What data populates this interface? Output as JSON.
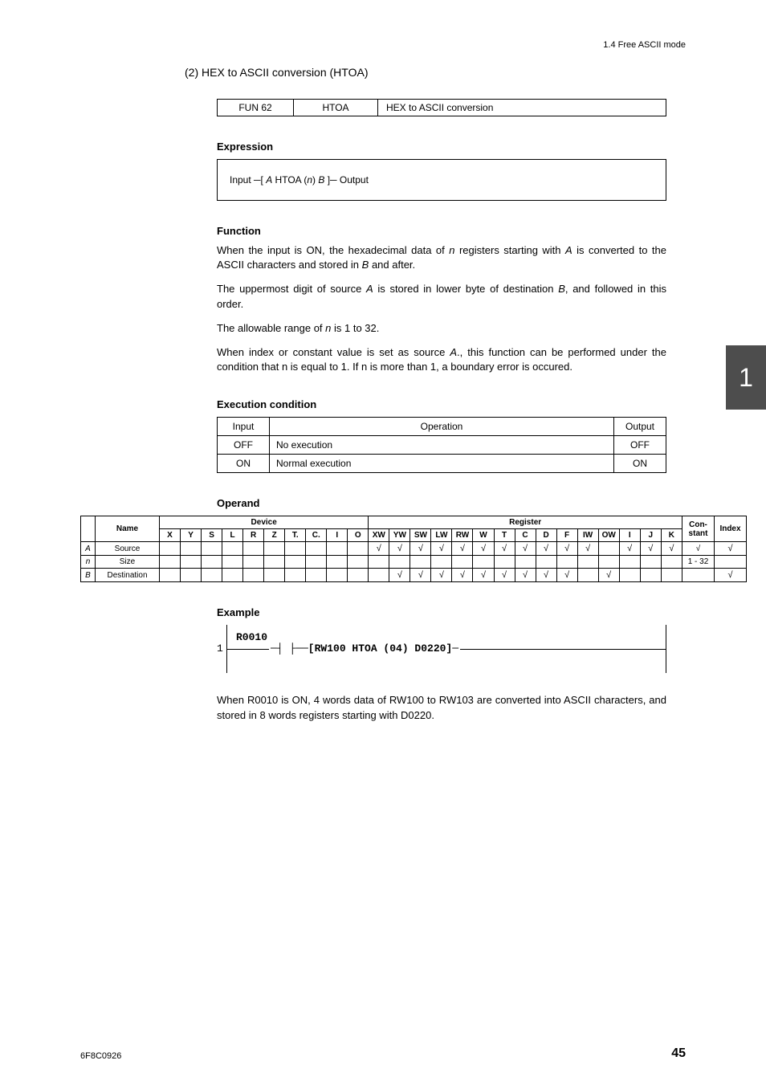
{
  "header": "1.4  Free ASCII mode",
  "section": "(2)  HEX to ASCII conversion (HTOA)",
  "info": {
    "col1": "FUN 62",
    "col2": "HTOA",
    "col3": "HEX to ASCII conversion"
  },
  "h_expr": "Expression",
  "expr_prefix": "Input ─[ ",
  "expr_a": "A",
  "expr_mid1": " HTOA (",
  "expr_n": "n",
  "expr_mid2": ")  ",
  "expr_b": "B",
  "expr_suffix": " ]─ Output",
  "h_func": "Function",
  "func_p1a": "When the input is ON, the hexadecimal data of ",
  "func_p1b": " registers starting with ",
  "func_p1c": " is converted to the ASCII characters and stored in ",
  "func_p1d": " and after.",
  "func_p2a": "The uppermost digit of source ",
  "func_p2b": " is stored in lower byte of destination ",
  "func_p2c": ", and followed in this order.",
  "func_p3a": "The allowable range of ",
  "func_p3b": " is 1 to 32.",
  "func_p4a": "When index or constant value is set as source ",
  "func_p4b": "., this function can be performed under the condition that n is equal to 1. If n is more than 1, a boundary error is occured.",
  "h_exec": "Execution condition",
  "exec": {
    "h1": "Input",
    "h2": "Operation",
    "h3": "Output",
    "r1c1": "OFF",
    "r1c2": "No execution",
    "r1c3": "OFF",
    "r2c1": "ON",
    "r2c2": "Normal execution",
    "r2c3": "ON"
  },
  "h_operand": "Operand",
  "operand": {
    "name": "Name",
    "device": "Device",
    "register": "Register",
    "constant": "Con-stant",
    "index": "Index",
    "dev": [
      "X",
      "Y",
      "S",
      "L",
      "R",
      "Z",
      "T.",
      "C.",
      "I",
      "O"
    ],
    "reg": [
      "XW",
      "YW",
      "SW",
      "LW",
      "RW",
      "W",
      "T",
      "C",
      "D",
      "F",
      "IW",
      "OW",
      "I",
      "J",
      "K"
    ],
    "rows": [
      {
        "key": "A",
        "name": "Source",
        "dev": [
          "",
          "",
          "",
          "",
          "",
          "",
          "",
          "",
          "",
          ""
        ],
        "reg": [
          "√",
          "√",
          "√",
          "√",
          "√",
          "√",
          "√",
          "√",
          "√",
          "√",
          "√",
          "",
          "√",
          "√",
          "√"
        ],
        "const": "√",
        "idx": "√"
      },
      {
        "key": "n",
        "name": "Size",
        "dev": [
          "",
          "",
          "",
          "",
          "",
          "",
          "",
          "",
          "",
          ""
        ],
        "reg": [
          "",
          "",
          "",
          "",
          "",
          "",
          "",
          "",
          "",
          "",
          "",
          "",
          "",
          "",
          ""
        ],
        "const": "1 - 32",
        "idx": ""
      },
      {
        "key": "B",
        "name": "Destination",
        "dev": [
          "",
          "",
          "",
          "",
          "",
          "",
          "",
          "",
          "",
          ""
        ],
        "reg": [
          "",
          "√",
          "√",
          "√",
          "√",
          "√",
          "√",
          "√",
          "√",
          "√",
          "",
          "√",
          "",
          "",
          ""
        ],
        "const": "",
        "idx": "√"
      }
    ]
  },
  "h_example": "Example",
  "example": {
    "r0010": "R0010",
    "rung": "1",
    "inst": "─┤ ├──[RW100  HTOA (04) D0220]─"
  },
  "example_desc": "When R0010 is ON, 4 words data of RW100 to RW103 are converted into ASCII characters, and stored in 8 words registers starting with D0220.",
  "side": "1",
  "footer_l": "6F8C0926",
  "footer_r": "45",
  "italic": {
    "n": "n",
    "A": "A",
    "B": "B"
  }
}
